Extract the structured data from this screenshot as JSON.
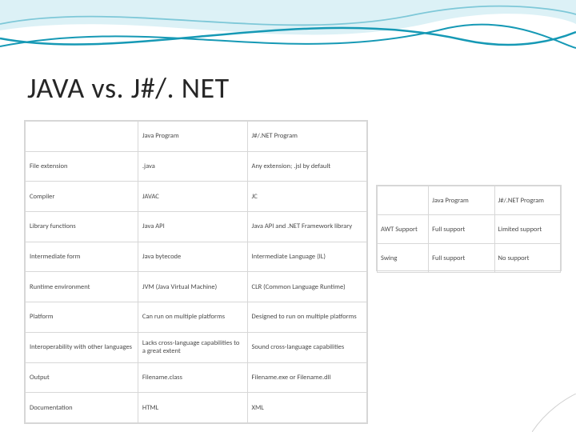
{
  "title": "JAVA vs.  J#/. NET",
  "table1": {
    "header": [
      "",
      "Java Program",
      "J#/.NET Program"
    ],
    "rows": [
      [
        "File extension",
        ".java",
        "Any extension; .jsl by default"
      ],
      [
        "Compiler",
        "JAVAC",
        "JC"
      ],
      [
        "Library functions",
        "Java API",
        "Java API and .NET Framework library"
      ],
      [
        "Intermediate form",
        "Java bytecode",
        "Intermediate Language (IL)"
      ],
      [
        "Runtime environment",
        "JVM (Java Virtual Machine)",
        "CLR (Common Language Runtime)"
      ],
      [
        "Platform",
        "Can run on multiple platforms",
        "Designed to run on multiple platforms"
      ],
      [
        "Interoperability with other languages",
        "Lacks cross-language capabilities to a great extent",
        "Sound cross-language capabilities"
      ],
      [
        "Output",
        "Filename.class",
        "Filename.exe or Filename.dll"
      ],
      [
        "Documentation",
        "HTML",
        "XML"
      ]
    ]
  },
  "table2": {
    "header": [
      "",
      "Java Program",
      "J#/.NET Program"
    ],
    "rows": [
      [
        "AWT Support",
        "Full support",
        "Limited support"
      ],
      [
        "Swing",
        "Full support",
        "No support"
      ]
    ]
  }
}
